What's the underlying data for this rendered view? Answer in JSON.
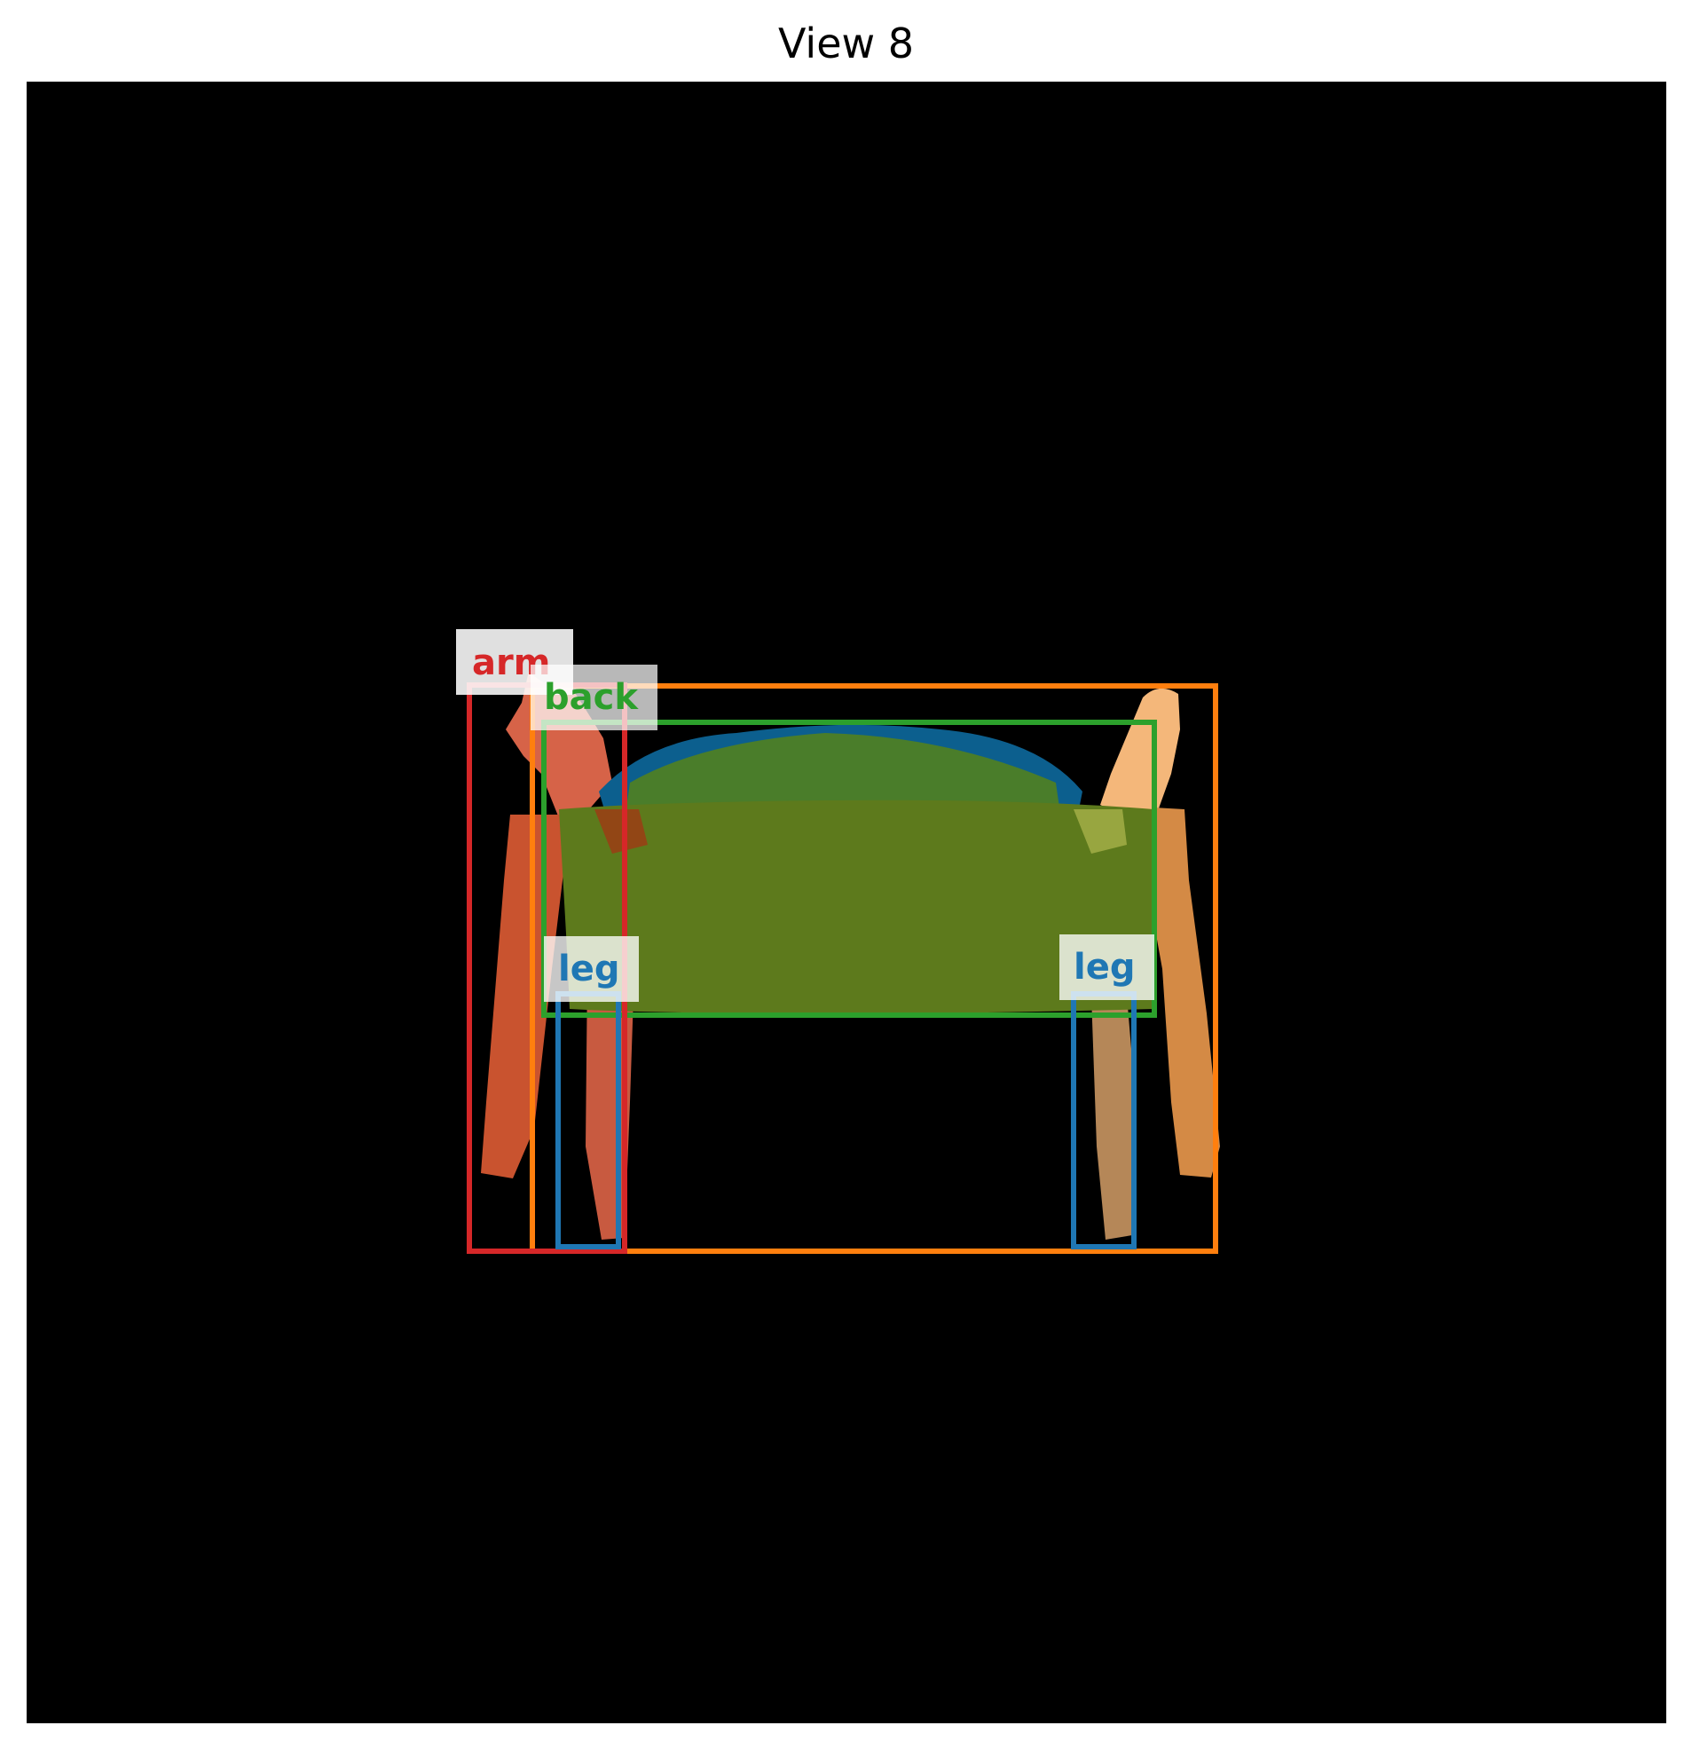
{
  "title": "View 8",
  "colors": {
    "background": "#000000",
    "arm": "#d62728",
    "back": "#2ca02c",
    "leg": "#1f77b4",
    "seat_box": "#ff7f0e"
  },
  "labels": {
    "arm": "arm",
    "back": "back",
    "leg_left": "leg",
    "leg_right": "leg"
  }
}
